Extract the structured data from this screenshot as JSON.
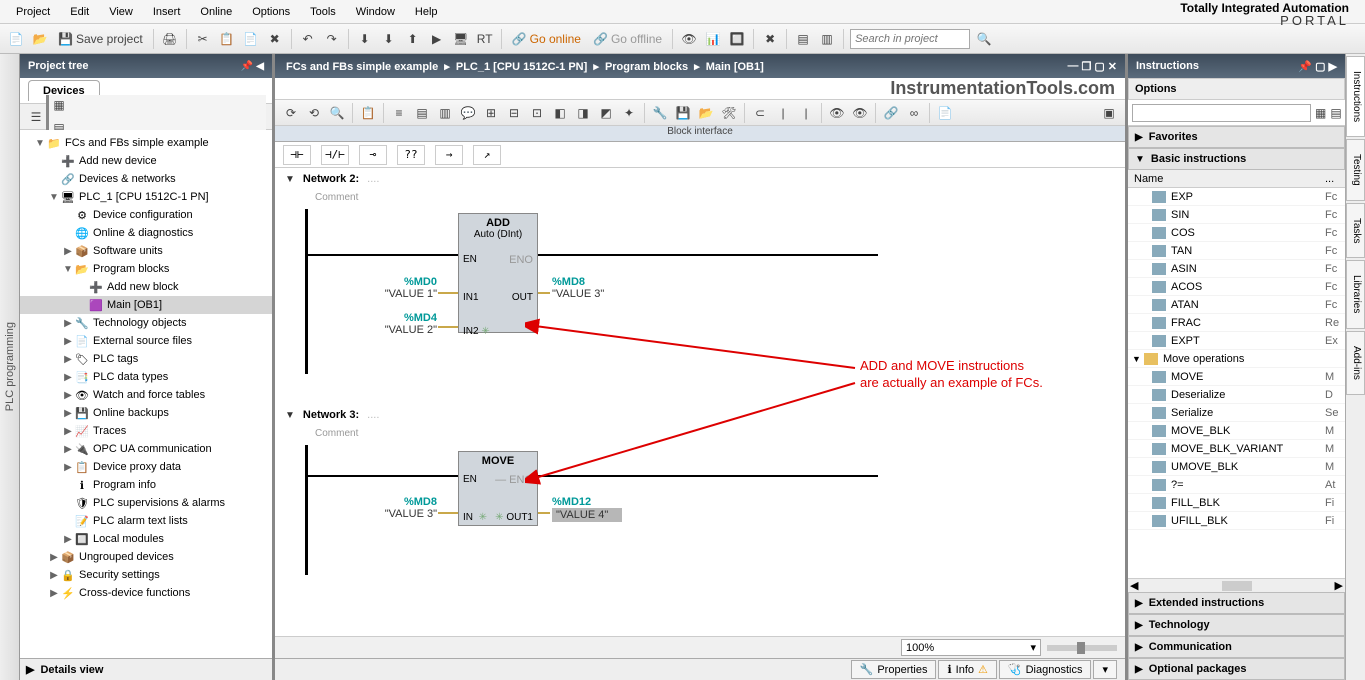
{
  "menu": [
    "Project",
    "Edit",
    "View",
    "Insert",
    "Online",
    "Options",
    "Tools",
    "Window",
    "Help"
  ],
  "brand": {
    "line1": "Totally Integrated Automation",
    "line2": "PORTAL"
  },
  "toolbar": {
    "save": "Save project",
    "goOnline": "Go online",
    "goOffline": "Go offline",
    "searchPlaceholder": "Search in project"
  },
  "leftVTab": "PLC programming",
  "projectTree": {
    "title": "Project tree",
    "tab": "Devices",
    "nodes": [
      {
        "lvl": 1,
        "exp": "▼",
        "ico": "📁",
        "txt": "FCs and FBs simple example"
      },
      {
        "lvl": 2,
        "exp": "",
        "ico": "➕",
        "txt": "Add new device"
      },
      {
        "lvl": 2,
        "exp": "",
        "ico": "🔗",
        "txt": "Devices & networks"
      },
      {
        "lvl": 2,
        "exp": "▼",
        "ico": "🖥",
        "txt": "PLC_1 [CPU 1512C-1 PN]"
      },
      {
        "lvl": 3,
        "exp": "",
        "ico": "⚙",
        "txt": "Device configuration"
      },
      {
        "lvl": 3,
        "exp": "",
        "ico": "🌐",
        "txt": "Online & diagnostics"
      },
      {
        "lvl": 3,
        "exp": "▶",
        "ico": "📦",
        "txt": "Software units"
      },
      {
        "lvl": 3,
        "exp": "▼",
        "ico": "📂",
        "txt": "Program blocks"
      },
      {
        "lvl": 4,
        "exp": "",
        "ico": "➕",
        "txt": "Add new block"
      },
      {
        "lvl": 4,
        "exp": "",
        "ico": "🟪",
        "txt": "Main [OB1]",
        "sel": true
      },
      {
        "lvl": 3,
        "exp": "▶",
        "ico": "🔧",
        "txt": "Technology objects"
      },
      {
        "lvl": 3,
        "exp": "▶",
        "ico": "📄",
        "txt": "External source files"
      },
      {
        "lvl": 3,
        "exp": "▶",
        "ico": "🏷",
        "txt": "PLC tags"
      },
      {
        "lvl": 3,
        "exp": "▶",
        "ico": "📑",
        "txt": "PLC data types"
      },
      {
        "lvl": 3,
        "exp": "▶",
        "ico": "👁",
        "txt": "Watch and force tables"
      },
      {
        "lvl": 3,
        "exp": "▶",
        "ico": "💾",
        "txt": "Online backups"
      },
      {
        "lvl": 3,
        "exp": "▶",
        "ico": "📈",
        "txt": "Traces"
      },
      {
        "lvl": 3,
        "exp": "▶",
        "ico": "🔌",
        "txt": "OPC UA communication"
      },
      {
        "lvl": 3,
        "exp": "▶",
        "ico": "📋",
        "txt": "Device proxy data"
      },
      {
        "lvl": 3,
        "exp": "",
        "ico": "ℹ",
        "txt": "Program info"
      },
      {
        "lvl": 3,
        "exp": "",
        "ico": "🛡",
        "txt": "PLC supervisions & alarms"
      },
      {
        "lvl": 3,
        "exp": "",
        "ico": "📝",
        "txt": "PLC alarm text lists"
      },
      {
        "lvl": 3,
        "exp": "▶",
        "ico": "🔲",
        "txt": "Local modules"
      },
      {
        "lvl": 2,
        "exp": "▶",
        "ico": "📦",
        "txt": "Ungrouped devices"
      },
      {
        "lvl": 2,
        "exp": "▶",
        "ico": "🔒",
        "txt": "Security settings"
      },
      {
        "lvl": 2,
        "exp": "▶",
        "ico": "⚡",
        "txt": "Cross-device functions"
      }
    ],
    "details": "Details view"
  },
  "breadcrumb": [
    "FCs and FBs simple example",
    "PLC_1 [CPU 1512C-1 PN]",
    "Program blocks",
    "Main [OB1]"
  ],
  "centerBrand": "InstrumentationTools.com",
  "blockInterface": "Block interface",
  "palette": [
    "⊣⊢",
    "⊣/⊢",
    "⊸",
    "??",
    "→",
    "↗"
  ],
  "networks": [
    {
      "title": "Network 2:",
      "comment": "Comment",
      "block": {
        "name": "ADD",
        "sub": "Auto (DInt)",
        "en": "EN",
        "eno": "ENO",
        "inputs": [
          {
            "pin": "IN1",
            "addr": "%MD0",
            "sym": "\"VALUE 1\""
          },
          {
            "pin": "IN2",
            "addr": "%MD4",
            "sym": "\"VALUE 2\"",
            "star": true
          }
        ],
        "outputs": [
          {
            "pin": "OUT",
            "addr": "%MD8",
            "sym": "\"VALUE 3\""
          }
        ]
      }
    },
    {
      "title": "Network 3:",
      "comment": "Comment",
      "block": {
        "name": "MOVE",
        "sub": "",
        "en": "EN",
        "eno": "ENO",
        "inputs": [
          {
            "pin": "IN",
            "addr": "%MD8",
            "sym": "\"VALUE 3\"",
            "star": true
          }
        ],
        "outputs": [
          {
            "pin": "OUT1",
            "addr": "%MD12",
            "sym": "\"VALUE 4\"",
            "hl": true,
            "star": true
          }
        ]
      }
    }
  ],
  "annotation": {
    "l1": "ADD and MOVE instructions",
    "l2": "are actually an example of FCs."
  },
  "zoom": "100%",
  "bottomTabs": [
    {
      "ico": "🔧",
      "txt": "Properties"
    },
    {
      "ico": "ℹ",
      "txt": "Info",
      "badge": "⚠"
    },
    {
      "ico": "🩺",
      "txt": "Diagnostics"
    }
  ],
  "instructions": {
    "title": "Instructions",
    "options": "Options",
    "favorites": "Favorites",
    "basic": "Basic instructions",
    "nameHdr": "Name",
    "list": [
      {
        "nm": "EXP",
        "t": "Fc"
      },
      {
        "nm": "SIN",
        "t": "Fc"
      },
      {
        "nm": "COS",
        "t": "Fc"
      },
      {
        "nm": "TAN",
        "t": "Fc"
      },
      {
        "nm": "ASIN",
        "t": "Fc"
      },
      {
        "nm": "ACOS",
        "t": "Fc"
      },
      {
        "nm": "ATAN",
        "t": "Fc"
      },
      {
        "nm": "FRAC",
        "t": "Re"
      },
      {
        "nm": "EXPT",
        "t": "Ex"
      },
      {
        "nm": "Move operations",
        "t": "",
        "folder": true,
        "exp": "▼"
      },
      {
        "nm": "MOVE",
        "t": "M"
      },
      {
        "nm": "Deserialize",
        "t": "D"
      },
      {
        "nm": "Serialize",
        "t": "Se"
      },
      {
        "nm": "MOVE_BLK",
        "t": "M"
      },
      {
        "nm": "MOVE_BLK_VARIANT",
        "t": "M"
      },
      {
        "nm": "UMOVE_BLK",
        "t": "M"
      },
      {
        "nm": "?=",
        "t": "At"
      },
      {
        "nm": "FILL_BLK",
        "t": "Fi"
      },
      {
        "nm": "UFILL_BLK",
        "t": "Fi"
      }
    ],
    "sections": [
      "Extended instructions",
      "Technology",
      "Communication",
      "Optional packages"
    ]
  },
  "rightVTabs": [
    "Instructions",
    "Testing",
    "Tasks",
    "Libraries",
    "Add-ins"
  ]
}
